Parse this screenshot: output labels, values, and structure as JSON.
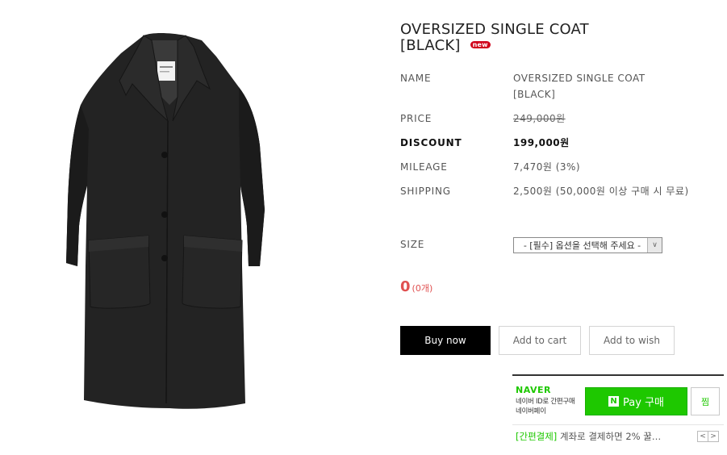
{
  "product": {
    "title_line1": "OVERSIZED SINGLE COAT",
    "title_line2": "[BLACK]",
    "new_badge": "new",
    "image_alt": "black oversized single coat"
  },
  "info": {
    "name_label": "NAME",
    "name_value_line1": "OVERSIZED SINGLE COAT",
    "name_value_line2": "[BLACK]",
    "price_label": "PRICE",
    "price_value": "249,000원",
    "discount_label": "DISCOUNT",
    "discount_value": "199,000원",
    "mileage_label": "MILEAGE",
    "mileage_value": "7,470원 (3%)",
    "shipping_label": "SHIPPING",
    "shipping_value": "2,500원 (50,000원 이상 구매 시 무료)"
  },
  "options": {
    "size_label": "SIZE",
    "size_selected": "- [필수] 옵션을 선택해 주세요 -"
  },
  "total": {
    "amount": "0",
    "count": "(0개)"
  },
  "actions": {
    "buy_now": "Buy now",
    "add_to_cart": "Add to cart",
    "add_to_wish": "Add to wish"
  },
  "naverpay": {
    "logo": "NAVER",
    "desc_line1": "네이버 ID로 간편구매",
    "desc_line2": "네이버페이",
    "button_n": "N",
    "button_label": "Pay 구매",
    "zzim": "찜",
    "promo_tag": "[간편결제]",
    "promo_text": " 계좌로 결제하면 2% 꿀…",
    "prev": "<",
    "next": ">"
  },
  "colors": {
    "accent_red": "#e05050",
    "naver_green": "#1ec800",
    "badge_red": "#d0021b"
  }
}
